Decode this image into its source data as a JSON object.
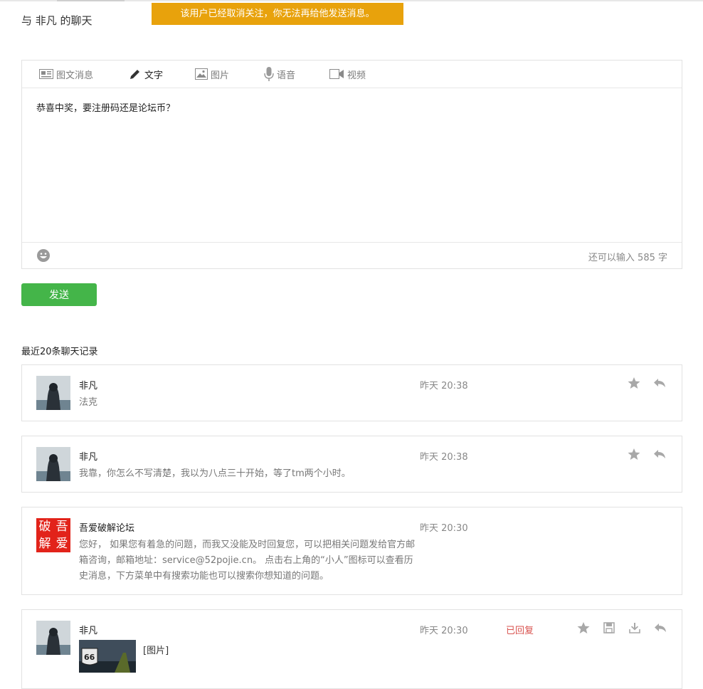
{
  "title": "与 非凡 的聊天",
  "warning": "该用户已经取消关注，你无法再给他发送消息。",
  "tabs": [
    {
      "label": "图文消息",
      "icon": "article-icon"
    },
    {
      "label": "文字",
      "icon": "pencil-icon"
    },
    {
      "label": "图片",
      "icon": "image-icon"
    },
    {
      "label": "语音",
      "icon": "microphone-icon"
    },
    {
      "label": "视频",
      "icon": "video-icon"
    }
  ],
  "editor": {
    "text": "恭喜中奖，要注册码还是论坛币？",
    "counter": "还可以输入 585 字"
  },
  "send_label": "发送",
  "history_title": "最近20条聊天记录",
  "messages": [
    {
      "sender": "非凡",
      "text": "法克",
      "time": "昨天 20:38"
    },
    {
      "sender": "非凡",
      "text": "我靠，你怎么不写清楚，我以为八点三十开始，等了tm两个小时。",
      "time": "昨天 20:38"
    },
    {
      "sender": "吾爱破解论坛",
      "text": "您好， 如果您有着急的问题，而我又没能及时回复您，可以把相关问题发给官方邮箱咨询，邮箱地址：service@52pojie.cn。 点击右上角的“小人”图标可以查看历史消息，下方菜单中有搜索功能也可以搜索你想知道的问题。",
      "time": "昨天 20:30",
      "avatar_text": [
        "破",
        "吾",
        "解",
        "爱"
      ]
    },
    {
      "sender": "非凡",
      "text": "[图片]",
      "time": "昨天 20:30",
      "status": "已回复",
      "thumb_text": "66"
    }
  ],
  "colors": {
    "warning": "#e8a20c",
    "send": "#44b549",
    "replied": "#d9534f"
  }
}
